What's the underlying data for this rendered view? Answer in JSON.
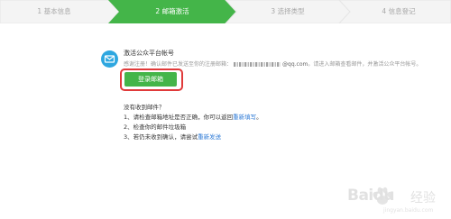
{
  "steps": [
    {
      "label": "1 基本信息",
      "active": false
    },
    {
      "label": "2 邮箱激活",
      "active": true
    },
    {
      "label": "3 选择类型",
      "active": false
    },
    {
      "label": "4 信息登记",
      "active": false
    }
  ],
  "activation": {
    "title": "激活公众平台帐号",
    "desc_prefix": "感谢注册！确认邮件已发送至你的注册邮箱：",
    "email_suffix": "@qq.com",
    "desc_suffix": "。请进入邮箱查看邮件，并激活公众平台帐号。",
    "login_button": "登录邮箱"
  },
  "help": {
    "title": "没有收到邮件？",
    "item1_text": "1、请检查邮箱地址是否正确，你可以返回",
    "item1_link": "重新填写",
    "item1_end": "。",
    "item2_text": "2、检查你的邮件垃圾箱",
    "item3_text": "3、若仍未收到确认，请尝试",
    "item3_link": "重新发送"
  },
  "watermark": {
    "brand": "Baidu",
    "cn": "经验",
    "url": "jingyan.baidu.com"
  },
  "colors": {
    "accent_green": "#44b549",
    "link_blue": "#2d7ad6",
    "highlight_red": "#e03a3a",
    "icon_blue": "#2ea7e0"
  }
}
